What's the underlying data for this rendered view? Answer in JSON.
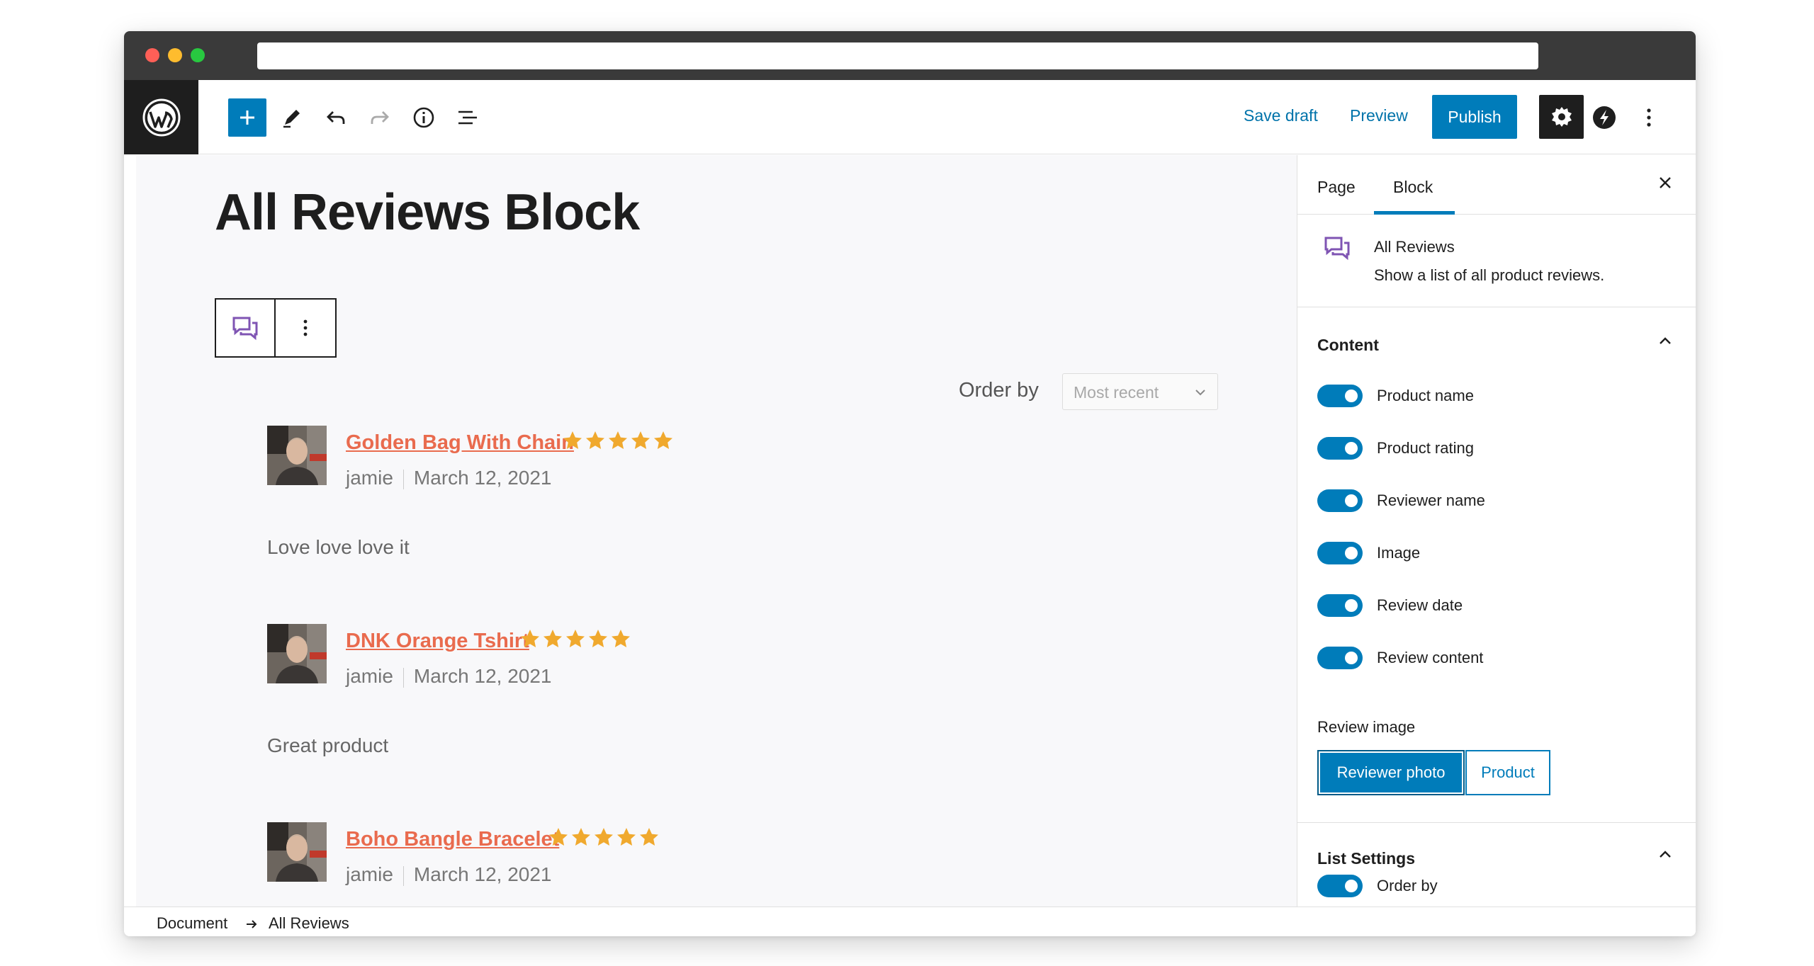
{
  "window": {
    "url": ""
  },
  "toolbar": {
    "save_draft": "Save draft",
    "preview": "Preview",
    "publish": "Publish"
  },
  "editor": {
    "page_title": "All Reviews Block",
    "order_by_label": "Order by",
    "order_by_value": "Most recent",
    "reviews": [
      {
        "product": "Golden Bag With Chain",
        "rating": 5,
        "reviewer": "jamie",
        "date": "March 12, 2021",
        "text": "Love love love it"
      },
      {
        "product": "DNK Orange Tshirt",
        "rating": 5,
        "reviewer": "jamie",
        "date": "March 12, 2021",
        "text": "Great product"
      },
      {
        "product": "Boho Bangle Bracelet",
        "rating": 5,
        "reviewer": "jamie",
        "date": "March 12, 2021",
        "text": ""
      }
    ]
  },
  "sidebar": {
    "tabs": [
      "Page",
      "Block"
    ],
    "active_tab": "Block",
    "block_card": {
      "title": "All Reviews",
      "description": "Show a list of all product reviews."
    },
    "content_panel": {
      "title": "Content",
      "toggles": [
        {
          "label": "Product name",
          "on": true
        },
        {
          "label": "Product rating",
          "on": true
        },
        {
          "label": "Reviewer name",
          "on": true
        },
        {
          "label": "Image",
          "on": true
        },
        {
          "label": "Review date",
          "on": true
        },
        {
          "label": "Review content",
          "on": true
        }
      ],
      "review_image_label": "Review image",
      "review_image_options": [
        "Reviewer photo",
        "Product"
      ],
      "review_image_selected": "Reviewer photo"
    },
    "list_settings_panel": {
      "title": "List Settings",
      "toggles": [
        {
          "label": "Order by",
          "on": true
        }
      ]
    }
  },
  "footer": {
    "breadcrumb": [
      "Document",
      "All Reviews"
    ]
  },
  "colors": {
    "accent": "#007cba",
    "product_link": "#e96b4e",
    "star": "#f0a92e",
    "block_icon": "#7f54b3"
  }
}
